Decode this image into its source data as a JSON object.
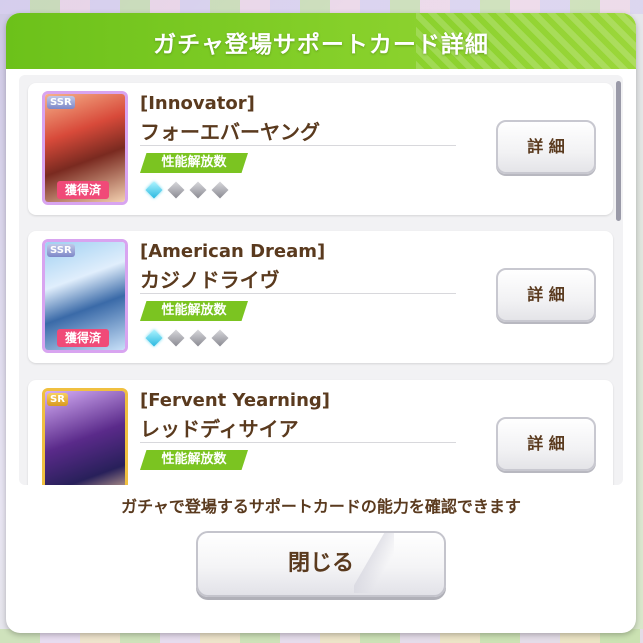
{
  "dialog": {
    "title": "ガチャ登場サポートカード詳細",
    "description": "ガチャで登場するサポートカードの能力を確認できます",
    "close_label": "閉じる",
    "header_color": "#7bc421"
  },
  "cards": [
    {
      "title": "[Innovator]",
      "name": "フォーエバーヤング",
      "rarity": "SSR",
      "obtained_label": "獲得済",
      "performance_label": "性能解放数",
      "unlock_level": 1,
      "unlock_max": 4,
      "detail_label": "詳 細"
    },
    {
      "title": "[American Dream]",
      "name": "カジノドライヴ",
      "rarity": "SSR",
      "obtained_label": "獲得済",
      "performance_label": "性能解放数",
      "unlock_level": 1,
      "unlock_max": 4,
      "detail_label": "詳 細"
    },
    {
      "title": "[Fervent Yearning]",
      "name": "レッドディサイア",
      "rarity": "SR",
      "performance_label": "性能解放数",
      "detail_label": "詳 細"
    }
  ]
}
